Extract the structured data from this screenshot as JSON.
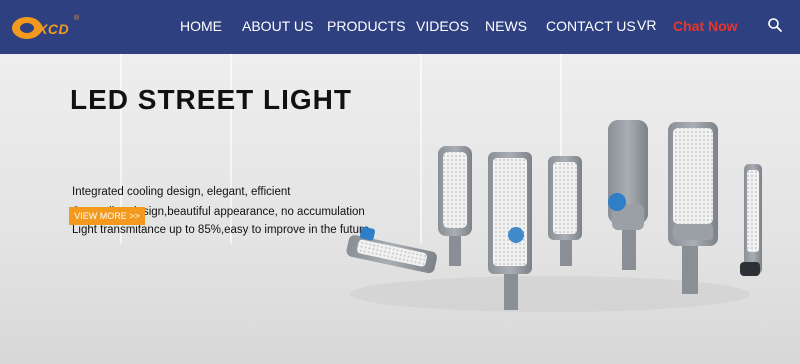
{
  "header": {
    "logo": {
      "text": "XCD",
      "reg": "®"
    },
    "nav": [
      {
        "label": "HOME"
      },
      {
        "label": "ABOUT US"
      },
      {
        "label": "PRODUCTS"
      },
      {
        "label": "VIDEOS"
      },
      {
        "label": "NEWS"
      },
      {
        "label": "CONTACT US"
      },
      {
        "label": "VR"
      },
      {
        "label": "Chat Now"
      }
    ],
    "icons": {
      "search": "search-icon"
    },
    "colors": {
      "nav_bg": "#2f4080",
      "chat_now": "#e6352b",
      "accent": "#f39a1e"
    }
  },
  "hero": {
    "title": "LED STREET LIGHT",
    "features": [
      "Integrated cooling design, elegant, efficient",
      "Streamline design,beautiful appearance, no accumulation",
      "Light transmitance up to 85%,easy to improve in the future"
    ],
    "cta_label": "VIEW MORE  >>"
  }
}
